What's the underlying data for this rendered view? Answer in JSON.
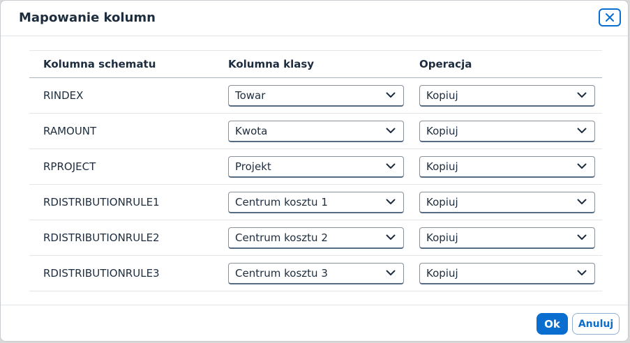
{
  "dialog": {
    "title": "Mapowanie kolumn",
    "close_icon": "close-icon"
  },
  "table": {
    "headers": {
      "schema_column": "Kolumna schematu",
      "class_column": "Kolumna klasy",
      "operation": "Operacja"
    },
    "rows": [
      {
        "schema": "RINDEX",
        "class_col": "Towar",
        "operation": "Kopiuj"
      },
      {
        "schema": "RAMOUNT",
        "class_col": "Kwota",
        "operation": "Kopiuj"
      },
      {
        "schema": "RPROJECT",
        "class_col": "Projekt",
        "operation": "Kopiuj"
      },
      {
        "schema": "RDISTRIBUTIONRULE1",
        "class_col": "Centrum kosztu 1",
        "operation": "Kopiuj"
      },
      {
        "schema": "RDISTRIBUTIONRULE2",
        "class_col": "Centrum kosztu 2",
        "operation": "Kopiuj"
      },
      {
        "schema": "RDISTRIBUTIONRULE3",
        "class_col": "Centrum kosztu 3",
        "operation": "Kopiuj"
      }
    ]
  },
  "footer": {
    "ok_label": "Ok",
    "cancel_label": "Anuluj"
  },
  "colors": {
    "accent": "#0a6ed1",
    "text": "#1d2d3e"
  },
  "icons": {
    "dropdown": "chevron-down-icon"
  }
}
